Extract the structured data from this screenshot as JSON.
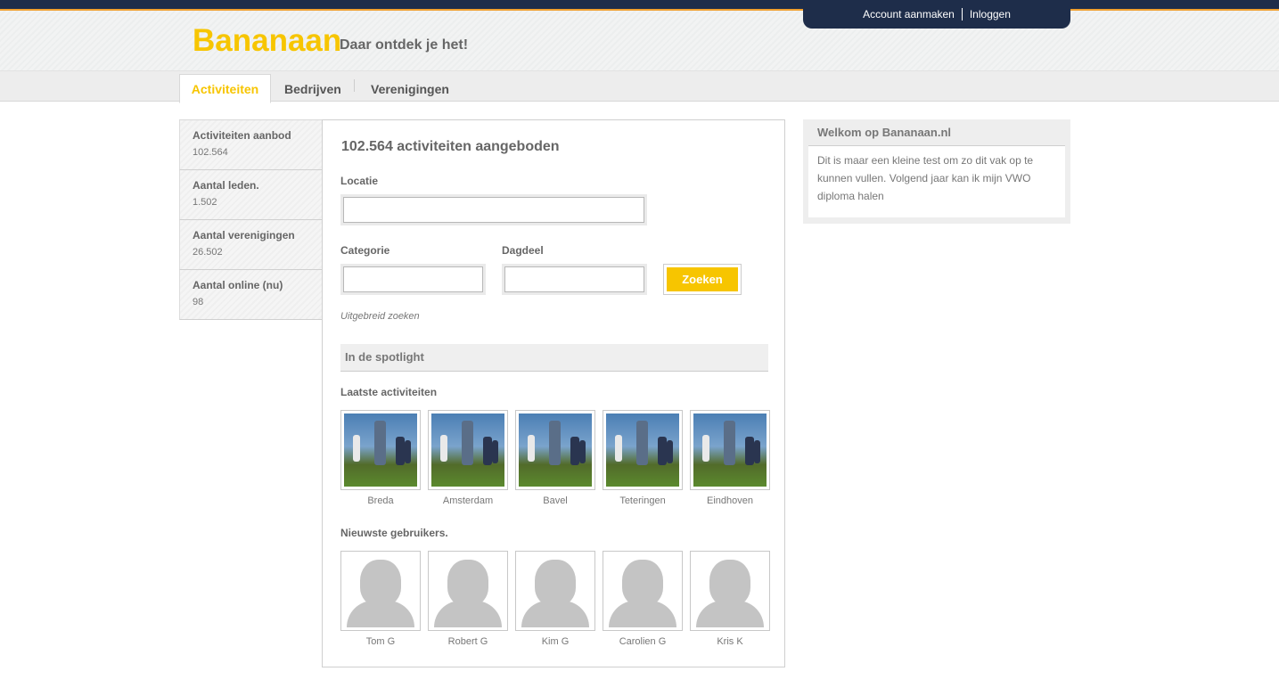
{
  "header": {
    "logo": "Bananaan",
    "slogan": "Daar ontdek je het!",
    "account_link": "Account aanmaken",
    "login_link": "Inloggen"
  },
  "nav": {
    "tabs": [
      {
        "label": "Activiteiten"
      },
      {
        "label": "Bedrijven"
      },
      {
        "label": "Verenigingen"
      }
    ]
  },
  "sidebar": {
    "items": [
      {
        "title": "Activiteiten aanbod",
        "value": "102.564"
      },
      {
        "title": "Aantal leden.",
        "value": "1.502"
      },
      {
        "title": "Aantal verenigingen",
        "value": "26.502"
      },
      {
        "title": "Aantal online (nu)",
        "value": "98"
      }
    ]
  },
  "main": {
    "title": "102.564 activiteiten aangeboden",
    "locatie_label": "Locatie",
    "locatie_value": "",
    "categorie_label": "Categorie",
    "categorie_value": "",
    "dagdeel_label": "Dagdeel",
    "dagdeel_value": "",
    "search_button": "Zoeken",
    "advanced_link": "Uitgebreid zoeken",
    "spotlight_title": "In de spotlight",
    "latest_title": "Laatste activiteiten",
    "activities": [
      "Breda",
      "Amsterdam",
      "Bavel",
      "Teteringen",
      "Eindhoven"
    ],
    "newest_title": "Nieuwste gebruikers.",
    "users": [
      "Tom G",
      "Robert G",
      "Kim G",
      "Carolien G",
      "Kris K"
    ]
  },
  "welcome": {
    "title": "Welkom op Bananaan.nl",
    "body": "Dit is maar een kleine test om zo dit vak op te kunnen vullen. Volgend jaar kan ik mijn VWO diploma halen"
  },
  "colors": {
    "brand": "#f7c500",
    "navy": "#1e2d4a",
    "accent_line": "#f0a030"
  }
}
